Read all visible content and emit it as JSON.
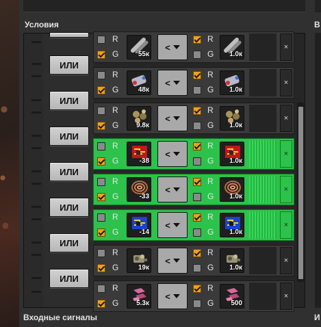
{
  "conditions_header": "Условия",
  "input_signals_header": "Входные сигналы",
  "right_header_1": "В",
  "right_header_2": "И",
  "or_label": "ИЛИ",
  "red_label": "R",
  "green_label": "G",
  "remove_symbol": "×",
  "colors": {
    "active": "#2cc24b",
    "inactive": "#3a3a3a",
    "checkbox_on": "#f0a019"
  },
  "rows": [
    {
      "icon": "pipe-icon",
      "first_count": "55к",
      "op": "<",
      "second_count": "1.0к",
      "first_red": false,
      "first_green": true,
      "second_red": true,
      "second_green": false,
      "active": false
    },
    {
      "icon": "battery-icon",
      "first_count": "48к",
      "op": "<",
      "second_count": "1.0к",
      "first_red": false,
      "first_green": true,
      "second_red": true,
      "second_green": false,
      "active": false
    },
    {
      "icon": "ore-icon",
      "first_count": "9.8к",
      "op": "<",
      "second_count": "1.0к",
      "first_red": false,
      "first_green": true,
      "second_red": true,
      "second_green": false,
      "active": false
    },
    {
      "icon": "advanced-circuit-icon",
      "first_count": "-38",
      "op": "<",
      "second_count": "1.0к",
      "first_red": false,
      "first_green": true,
      "second_red": true,
      "second_green": false,
      "active": true
    },
    {
      "icon": "copper-cable-icon",
      "first_count": "-33",
      "op": "<",
      "second_count": "1.0к",
      "first_red": false,
      "first_green": true,
      "second_red": true,
      "second_green": false,
      "active": true
    },
    {
      "icon": "processing-unit-icon",
      "first_count": "-14",
      "op": "<",
      "second_count": "1.0к",
      "first_red": false,
      "first_green": true,
      "second_red": true,
      "second_green": false,
      "active": true
    },
    {
      "icon": "engine-icon",
      "first_count": "19к",
      "op": "<",
      "second_count": "1.0к",
      "first_red": false,
      "first_green": true,
      "second_red": true,
      "second_green": false,
      "active": false
    },
    {
      "icon": "brick-icon",
      "first_count": "5.3к",
      "op": "<",
      "second_count": "500",
      "first_red": false,
      "first_green": true,
      "second_red": true,
      "second_green": false,
      "active": false
    }
  ]
}
